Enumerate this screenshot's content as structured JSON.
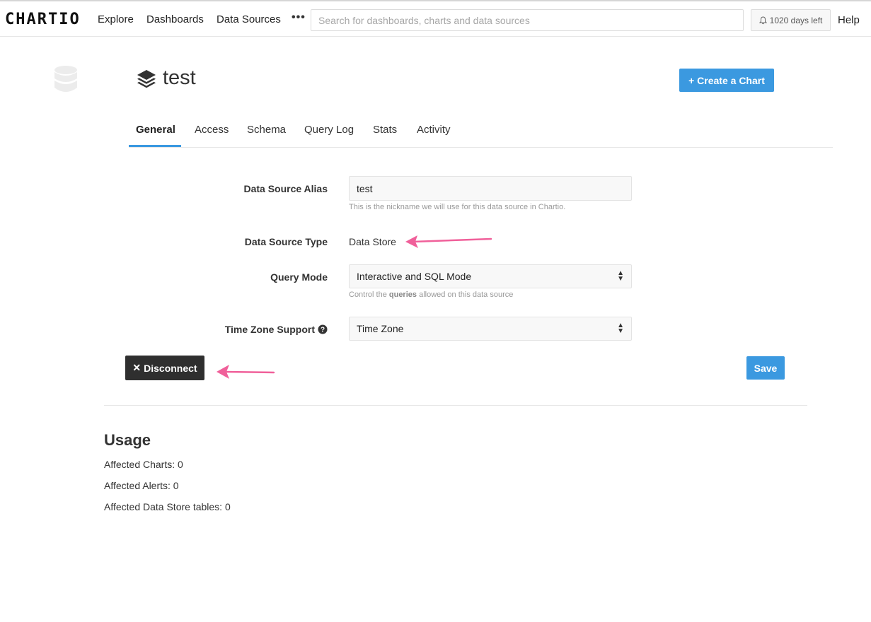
{
  "topbar": {
    "logo": "CHARTIO",
    "nav": [
      "Explore",
      "Dashboards",
      "Data Sources"
    ],
    "more": "•••",
    "search_placeholder": "Search for dashboards, charts and data sources",
    "trial": "1020 days left",
    "help": "Help"
  },
  "header": {
    "title": "test",
    "create_button": "+ Create a Chart"
  },
  "tabs": [
    "General",
    "Access",
    "Schema",
    "Query Log",
    "Stats",
    "Activity"
  ],
  "form": {
    "alias": {
      "label": "Data Source Alias",
      "value": "test",
      "help": "This is the nickname we will use for this data source in Chartio."
    },
    "type": {
      "label": "Data Source Type",
      "value": "Data Store"
    },
    "query_mode": {
      "label": "Query Mode",
      "value": "Interactive and SQL Mode",
      "help_prefix": "Control the ",
      "help_bold": "queries",
      "help_suffix": " allowed on this data source"
    },
    "timezone": {
      "label": "Time Zone Support",
      "value": "Time Zone"
    }
  },
  "actions": {
    "disconnect": "Disconnect",
    "save": "Save"
  },
  "usage": {
    "title": "Usage",
    "lines": [
      "Affected Charts: 0",
      "Affected Alerts: 0",
      "Affected Data Store tables: 0"
    ]
  },
  "colors": {
    "primary": "#3b99e0",
    "dark_button": "#2f2f2f",
    "annotation_arrow": "#f0609a"
  }
}
